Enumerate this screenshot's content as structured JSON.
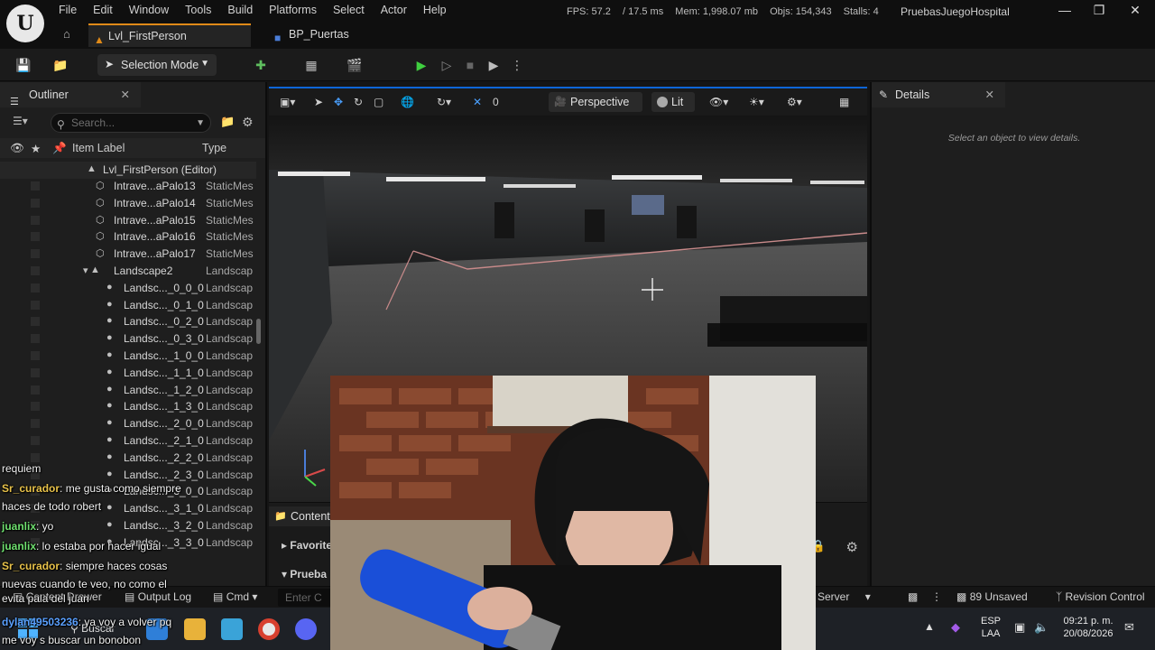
{
  "menu": {
    "items": [
      "File",
      "Edit",
      "Window",
      "Tools",
      "Build",
      "Platforms",
      "Select",
      "Actor",
      "Help"
    ]
  },
  "stats": {
    "fps": "FPS: 57.2",
    "frame_ms": "/ 17.5 ms",
    "mem": "Mem: 1,998.07 mb",
    "objs": "Objs: 154,343",
    "stalls": "Stalls: 4"
  },
  "project_name": "PruebasJuegoHospital",
  "tabs": [
    {
      "label": "Lvl_FirstPerson"
    },
    {
      "label": "BP_Puertas"
    }
  ],
  "toolbar": {
    "selection_mode": "Selection Mode"
  },
  "outliner": {
    "tab_label": "Outliner",
    "search_placeholder": "Search...",
    "col_label": "Item Label",
    "col_type": "Type",
    "root": "Lvl_FirstPerson (Editor)",
    "rows": [
      {
        "label": "Intrave...aPalo13",
        "type": "StaticMes",
        "indent": 1
      },
      {
        "label": "Intrave...aPalo14",
        "type": "StaticMes",
        "indent": 1
      },
      {
        "label": "Intrave...aPalo15",
        "type": "StaticMes",
        "indent": 1
      },
      {
        "label": "Intrave...aPalo16",
        "type": "StaticMes",
        "indent": 1
      },
      {
        "label": "Intrave...aPalo17",
        "type": "StaticMes",
        "indent": 1
      },
      {
        "label": "Landscape2",
        "type": "Landscap",
        "indent": 0
      },
      {
        "label": "Landsc..._0_0_0",
        "type": "Landscap",
        "indent": 2
      },
      {
        "label": "Landsc..._0_1_0",
        "type": "Landscap",
        "indent": 2
      },
      {
        "label": "Landsc..._0_2_0",
        "type": "Landscap",
        "indent": 2
      },
      {
        "label": "Landsc..._0_3_0",
        "type": "Landscap",
        "indent": 2
      },
      {
        "label": "Landsc..._1_0_0",
        "type": "Landscap",
        "indent": 2
      },
      {
        "label": "Landsc..._1_1_0",
        "type": "Landscap",
        "indent": 2
      },
      {
        "label": "Landsc..._1_2_0",
        "type": "Landscap",
        "indent": 2
      },
      {
        "label": "Landsc..._1_3_0",
        "type": "Landscap",
        "indent": 2
      },
      {
        "label": "Landsc..._2_0_0",
        "type": "Landscap",
        "indent": 2
      },
      {
        "label": "Landsc..._2_1_0",
        "type": "Landscap",
        "indent": 2
      },
      {
        "label": "Landsc..._2_2_0",
        "type": "Landscap",
        "indent": 2
      },
      {
        "label": "Landsc..._2_3_0",
        "type": "Landscap",
        "indent": 2
      },
      {
        "label": "Landsc..._3_0_0",
        "type": "Landscap",
        "indent": 2
      },
      {
        "label": "Landsc..._3_1_0",
        "type": "Landscap",
        "indent": 2
      },
      {
        "label": "Landsc..._3_2_0",
        "type": "Landscap",
        "indent": 2
      },
      {
        "label": "Landsc..._3_3_0",
        "type": "Landscap",
        "indent": 2
      }
    ]
  },
  "viewport": {
    "snap_value": "0",
    "perspective": "Perspective",
    "lit": "Lit"
  },
  "details": {
    "tab_label": "Details",
    "empty_text": "Select an object to view details."
  },
  "content_browser": {
    "tab_label": "Content",
    "favorites": "Favorite",
    "project_folder": "Prueba"
  },
  "statusbar": {
    "content_drawer": "Content Drawer",
    "output_log": "Output Log",
    "cmd": "Cmd",
    "cmd_placeholder": "Enter C",
    "source_control": "Server",
    "unsaved": "89 Unsaved",
    "revision_control": "Revision Control"
  },
  "taskbar": {
    "search": "Buscar",
    "lang": "ESP",
    "layout": "LAA",
    "time": "09:21 p. m.",
    "date": "20/08/2026"
  },
  "chat": [
    {
      "user": "",
      "text": "requiem",
      "color": "#ffffff"
    },
    {
      "user": "Sr_curador",
      "text": ": me gusta como siempre",
      "color": "#e8c24a"
    },
    {
      "user": "",
      "text": "haces de todo robert",
      "color": "#ffffff"
    },
    {
      "user": "juanlix",
      "text": ": yo",
      "color": "#6fe06f"
    },
    {
      "user": "juanlix",
      "text": ": lo estaba por hacer igual",
      "color": "#6fe06f"
    },
    {
      "user": "Sr_curador",
      "text": ": siempre haces cosas",
      "color": "#e8c24a"
    },
    {
      "user": "",
      "text": "nuevas cuando te veo, no como el",
      "color": "#ffffff"
    },
    {
      "user": "",
      "text": "evita pala del juan",
      "color": "#ffffff"
    },
    {
      "user": "dylan49503236",
      "text": ": ya voy a volver pq",
      "color": "#5aa0ff"
    },
    {
      "user": "",
      "text": "me voy s buscar un bonobon",
      "color": "#ffffff"
    }
  ]
}
